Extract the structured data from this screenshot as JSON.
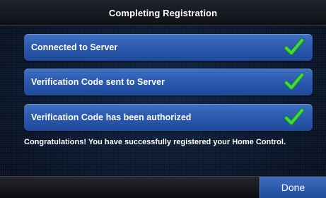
{
  "header": {
    "title": "Completing Registration"
  },
  "steps": [
    {
      "label": "Connected to Server",
      "status_icon": "green-check-icon",
      "complete": true
    },
    {
      "label": "Verification Code sent to Server",
      "status_icon": "green-check-icon",
      "complete": true
    },
    {
      "label": "Verification Code has been authorized",
      "status_icon": "green-check-icon",
      "complete": true
    }
  ],
  "message": "Congratulations! You have successfully registered your Home Control.",
  "footer": {
    "done_label": "Done"
  },
  "colors": {
    "row_blue": "#2a59ad",
    "check_green": "#3fd23f",
    "background": "#0a1830"
  }
}
